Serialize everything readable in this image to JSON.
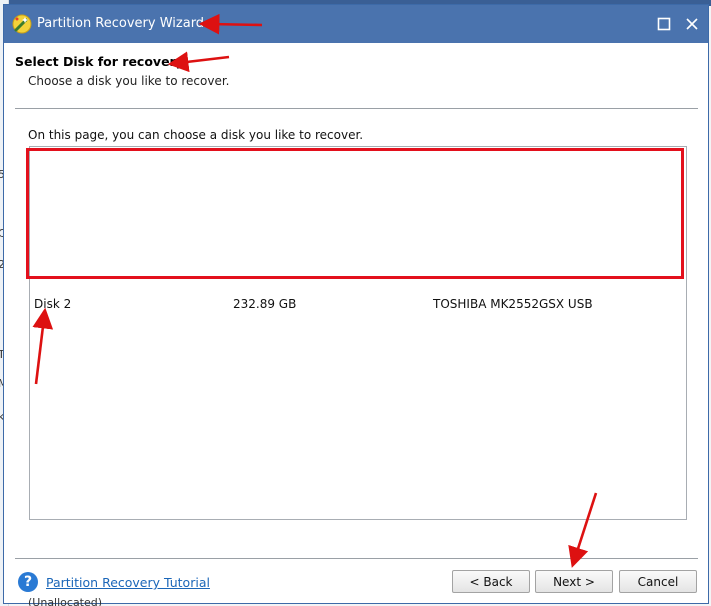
{
  "window": {
    "title": "Partition Recovery Wizard"
  },
  "header": {
    "title": "Select Disk for recovery",
    "subtitle": "Choose a disk you like to recover."
  },
  "main": {
    "instruction": "On this page, you can choose a disk you like to recover.",
    "disks": [
      {
        "name": "Disk 2",
        "size": "232.89 GB",
        "model": "TOSHIBA MK2552GSX USB"
      }
    ]
  },
  "footer": {
    "help_link": "Partition Recovery Tutorial",
    "back_label": "< Back",
    "next_label": "Next >",
    "cancel_label": "Cancel"
  },
  "background_fragments": [
    "59",
    "C",
    "2",
    "T",
    "M",
    "k",
    "(Unallocated)"
  ],
  "colors": {
    "titlebar": "#4a73ae",
    "highlight": "#e3101c",
    "annotation_arrow": "#dd1111",
    "link": "#1a66b8"
  }
}
